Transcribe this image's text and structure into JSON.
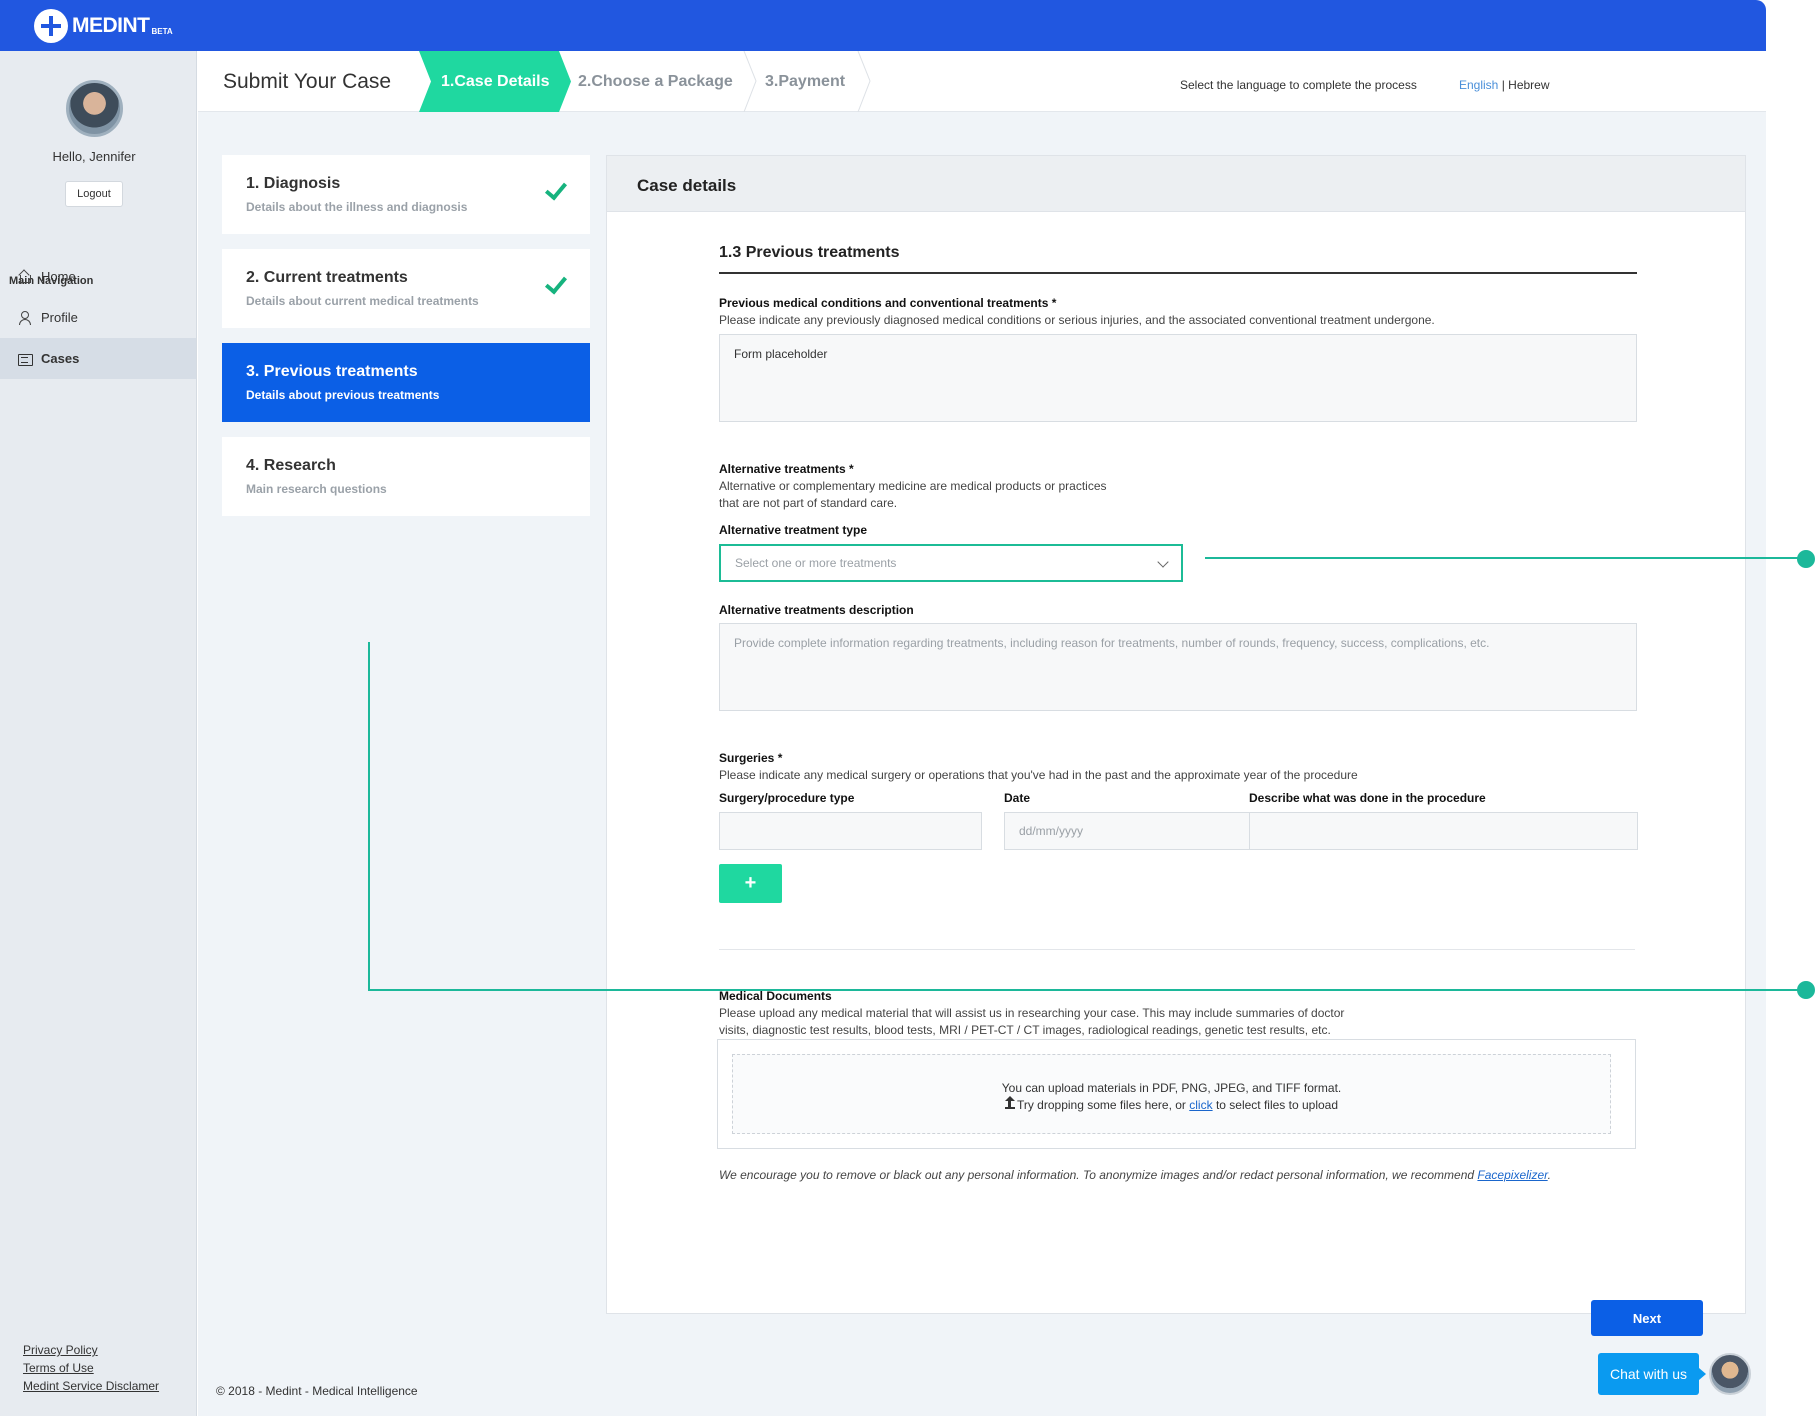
{
  "brand": {
    "name": "MEDINT",
    "badge": "BETA"
  },
  "sidebar": {
    "greeting": "Hello, Jennifer",
    "logout_label": "Logout",
    "nav_title": "Main Navigation",
    "items": [
      {
        "label": "Home",
        "icon": "home-icon",
        "active": false
      },
      {
        "label": "Profile",
        "icon": "profile-icon",
        "active": false
      },
      {
        "label": "Cases",
        "icon": "cases-icon",
        "active": true
      }
    ],
    "footer_links": [
      "Privacy Policy",
      "Terms of Use",
      "Medint Service Disclamer"
    ]
  },
  "header": {
    "title": "Submit Your Case",
    "steps": [
      "1.Case Details",
      "2.Choose a Package",
      "3.Payment"
    ],
    "language_prompt": "Select the language to complete the process",
    "languages": [
      "English",
      "Hebrew"
    ],
    "language_separator": "|"
  },
  "step_cards": [
    {
      "title": "1. Diagnosis",
      "subtitle": "Details about the illness and diagnosis",
      "completed": true,
      "active": false
    },
    {
      "title": "2. Current treatments",
      "subtitle": "Details about current medical treatments",
      "completed": true,
      "active": false
    },
    {
      "title": "3. Previous treatments",
      "subtitle": "Details about previous treatments",
      "completed": false,
      "active": true
    },
    {
      "title": "4. Research",
      "subtitle": "Main research questions",
      "completed": false,
      "active": false
    }
  ],
  "form": {
    "panel_title": "Case details",
    "section_title": "1.3 Previous treatments",
    "previous_conditions": {
      "label": "Previous medical conditions and conventional treatments *",
      "description": "Please indicate any previously diagnosed medical conditions or serious injuries, and the associated conventional treatment undergone.",
      "value": "Form placeholder"
    },
    "alternative": {
      "label": "Alternative treatments *",
      "description_line1": "Alternative or complementary medicine are medical products or practices",
      "description_line2": "that are not part of standard care.",
      "type_label": "Alternative treatment type",
      "type_placeholder": "Select one or more treatments",
      "description_label": "Alternative treatments description",
      "description_placeholder": "Provide complete information regarding treatments, including reason for treatments, number of rounds, frequency, success, complications, etc."
    },
    "surgeries": {
      "label": "Surgeries *",
      "description": "Please indicate any medical surgery or operations that you've had in the past and the approximate year of the procedure",
      "col_type": "Surgery/procedure type",
      "col_date": "Date",
      "col_describe": "Describe what was done in the procedure",
      "date_placeholder": "dd/mm/yyyy",
      "add_label": "+"
    },
    "documents": {
      "label": "Medical Documents",
      "description_line1": "Please upload any medical material that will assist us in researching your case. This may include summaries of doctor",
      "description_line2": "visits, diagnostic test results, blood tests, MRI / PET-CT / CT images, radiological readings, genetic test results, etc.",
      "formats": "You can upload materials in PDF, PNG, JPEG, and TIFF format.",
      "drop_before": "Try dropping some files here, or ",
      "drop_link": "click",
      "drop_after": " to select files to upload",
      "notice": "We encourage you to remove or black out any personal information. To anonymize images and/or redact personal information, we recommend",
      "notice_link": "Facepixelizer",
      "notice_end": "."
    },
    "next_label": "Next"
  },
  "footer": {
    "copyright": "© 2018 - Medint - Medical Intelligence",
    "chat_label": "Chat with us"
  },
  "colors": {
    "brand_blue": "#2157e0",
    "active_blue": "#0b5fe6",
    "accent_green": "#1fd8a0",
    "annotation_teal": "#1cb89a"
  }
}
